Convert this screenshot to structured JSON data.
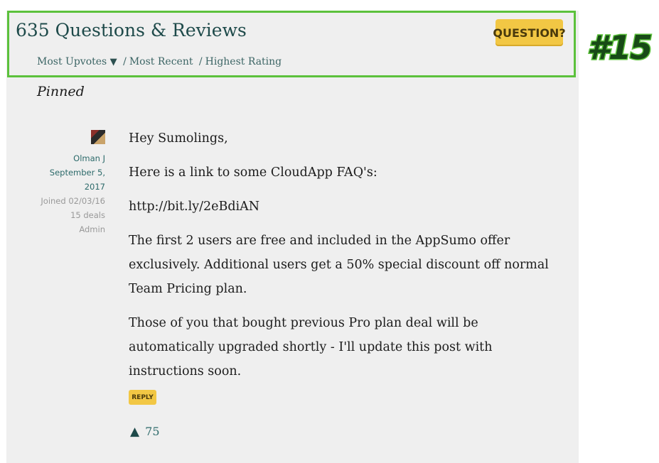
{
  "header": {
    "title": "635 Questions & Reviews",
    "question_button": "QUESTION?",
    "sort": {
      "most_upvotes": "Most Upvotes",
      "active_indicator": "▼",
      "separator": "/",
      "most_recent": "Most Recent",
      "highest_rating": "Highest Rating"
    }
  },
  "badge": "#15",
  "pinned_label": "Pinned",
  "post": {
    "author": {
      "name": "Olman J",
      "date": "September 5, 2017",
      "joined_label": "Joined",
      "joined_date": "02/03/16",
      "deals": "15 deals",
      "role": "Admin"
    },
    "paragraphs": [
      "Hey Sumolings,",
      "Here is a link to some CloudApp FAQ's:",
      "http://bit.ly/2eBdiAN",
      "The first 2 users are free and included in the AppSumo offer exclusively. Additional users get a 50% special discount off normal Team Pricing plan.",
      "Those of you that bought previous Pro plan deal will be automatically upgraded shortly - I'll update this post with instructions soon."
    ],
    "reply_label": "REPLY",
    "upvote_arrow": "▲",
    "upvote_count": "75"
  },
  "colors": {
    "highlight": "#5cc13c",
    "button": "#f2c744",
    "link": "#2c6a6a",
    "panel": "#efefef"
  }
}
